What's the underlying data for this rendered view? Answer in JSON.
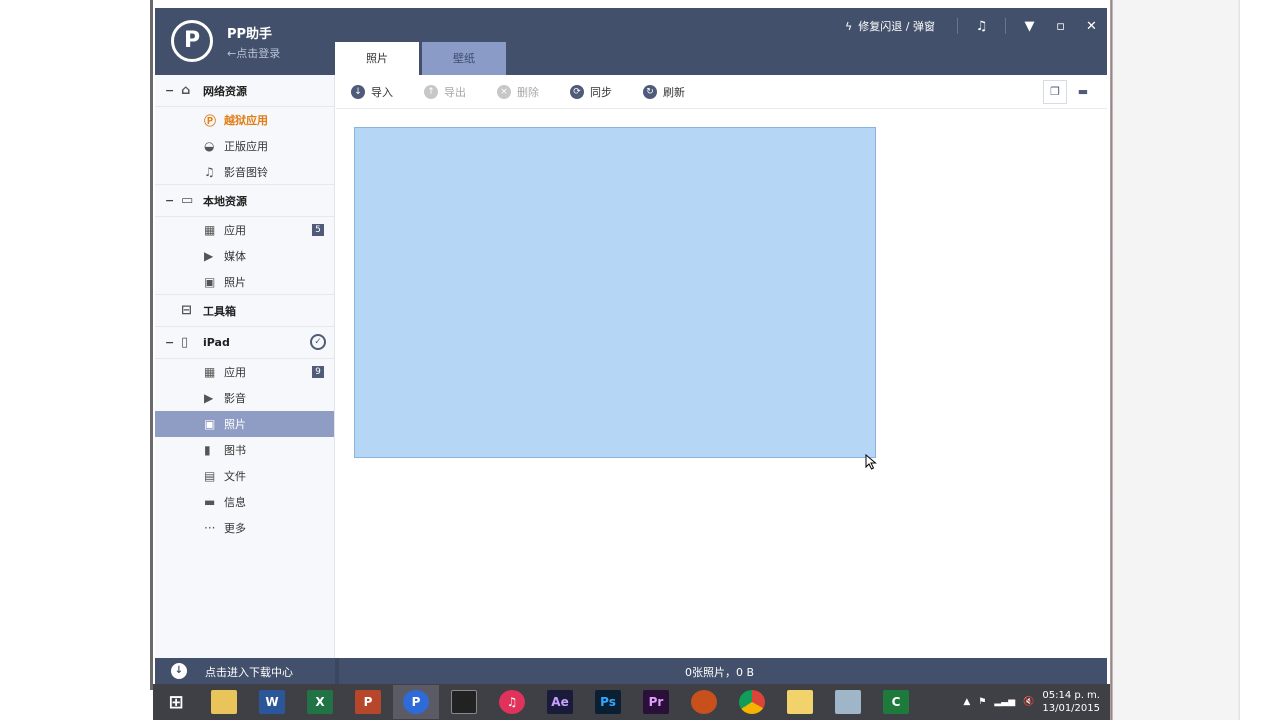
{
  "app": {
    "logo_text": "P",
    "name": "PP助手",
    "login_text": "←点击登录",
    "tabs": [
      {
        "label": "照片",
        "active": true
      },
      {
        "label": "壁纸",
        "active": false
      }
    ],
    "repair_label": "修复闪退 / 弹窗",
    "window_buttons": {
      "music": "♫",
      "menu": "▼",
      "minimize": "▫",
      "close": "✕"
    }
  },
  "sidebar": {
    "groups": [
      {
        "label": "网络资源",
        "icon": "home-icon",
        "collapse": "−"
      },
      {
        "label": "本地资源",
        "icon": "monitor-icon",
        "collapse": "−"
      },
      {
        "label": "工具箱",
        "icon": "toolbox-icon",
        "collapse": ""
      },
      {
        "label": "iPad",
        "icon": "tablet-icon",
        "collapse": "−"
      }
    ],
    "network_items": [
      {
        "label": "越狱应用",
        "icon": "pp-icon",
        "hot": true
      },
      {
        "label": "正版应用",
        "icon": "bag-icon"
      },
      {
        "label": "影音图铃",
        "icon": "music-note-icon"
      }
    ],
    "local_items": [
      {
        "label": "应用",
        "icon": "grid-icon",
        "badge": "5"
      },
      {
        "label": "媒体",
        "icon": "video-icon"
      },
      {
        "label": "照片",
        "icon": "photo-icon"
      }
    ],
    "ipad_items": [
      {
        "label": "应用",
        "icon": "grid-icon",
        "badge": "9"
      },
      {
        "label": "影音",
        "icon": "video-icon"
      },
      {
        "label": "照片",
        "icon": "photo-icon",
        "selected": true
      },
      {
        "label": "图书",
        "icon": "book-icon"
      },
      {
        "label": "文件",
        "icon": "file-icon"
      },
      {
        "label": "信息",
        "icon": "message-icon"
      },
      {
        "label": "更多",
        "icon": "more-icon"
      }
    ]
  },
  "toolbar": {
    "import": "导入",
    "export": "导出",
    "delete": "删除",
    "sync": "同步",
    "refresh": "刷新"
  },
  "status": {
    "download_center": "点击进入下载中心",
    "photo_count": "0张照片，0 B"
  },
  "taskbar": {
    "apps": [
      "windows",
      "explorer",
      "word",
      "excel",
      "powerpoint",
      "pp-assistant",
      "film",
      "itunes",
      "after-effects",
      "photoshop",
      "premiere",
      "app-swirl",
      "chrome",
      "folder",
      "remote",
      "camtasia",
      "scroll"
    ],
    "labels": {
      "word": "W",
      "excel": "X",
      "powerpoint": "P",
      "pp-assistant": "P",
      "after-effects": "Ae",
      "photoshop": "Ps",
      "premiere": "Pr",
      "camtasia": "C"
    },
    "time": "05:14 p. m.",
    "date": "13/01/2015"
  }
}
